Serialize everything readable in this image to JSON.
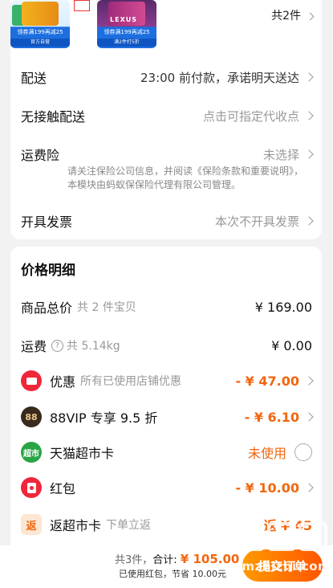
{
  "products": {
    "thumb1_promo": "领券满199再减25",
    "thumb1_store": "官方自营",
    "thumb2_brand": "LEXUS",
    "thumb2_promo": "领券满199再减25",
    "thumb2_store": "满2件打5折",
    "count_label": "共2件"
  },
  "delivery": {
    "rows": [
      {
        "label": "配送",
        "value": "23:00 前付款，承诺明天送达"
      },
      {
        "label": "无接触配送",
        "value": "点击可指定代收点"
      },
      {
        "label": "运费险",
        "value": "未选择"
      },
      {
        "label": "开具发票",
        "value": "本次不开具发票"
      }
    ],
    "insurance_note": "请关注保险公司信息，并阅读《保险条款和重要说明》，本模块由蚂蚁保保险代理有限公司管理。"
  },
  "price": {
    "title": "价格明细",
    "goods_total": {
      "label": "商品总价",
      "sub": "共 2 件宝贝",
      "value": "¥ 169.00"
    },
    "shipping": {
      "label": "运费",
      "sub": "共 5.14kg",
      "value": "¥ 0.00"
    },
    "discount": {
      "label": "优惠",
      "sub": "所有已使用店铺优惠",
      "value": "- ¥ 47.00"
    },
    "vip": {
      "icon_text": "88",
      "label": "88VIP 专享 9.5 折",
      "value": "- ¥ 6.10"
    },
    "market_card": {
      "icon_text": "超市",
      "label": "天猫超市卡",
      "value": "未使用"
    },
    "red_packet": {
      "label": "红包",
      "value": "- ¥ 10.00"
    },
    "cashback": {
      "icon_text": "返",
      "label": "返超市卡",
      "sub": "下单立返",
      "value": "返 ¥ 45"
    }
  },
  "footer": {
    "count": "共3件，",
    "total_label": "合计: ",
    "total_value": "¥ 105.00",
    "note": "已使用红包，节省 10.00元",
    "submit": "提交订单"
  },
  "watermark": {
    "url": "smzhizhi.com"
  },
  "colors": {
    "accent": "#f2660f",
    "red": "#f0263a",
    "submit_start": "#ff9a00",
    "submit_end": "#ff5500"
  }
}
